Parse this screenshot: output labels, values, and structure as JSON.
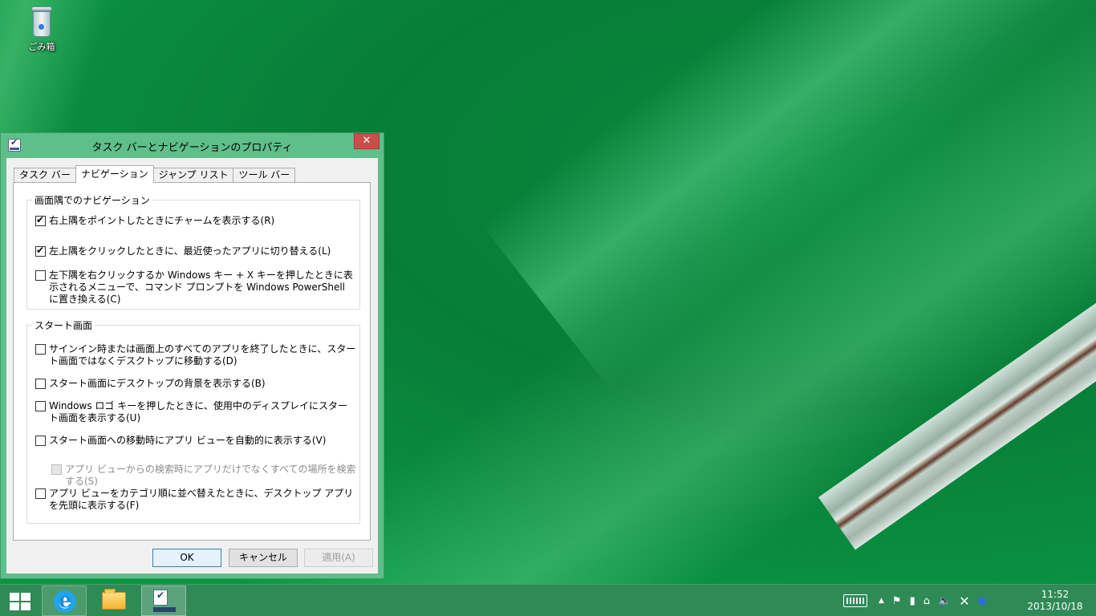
{
  "desktop": {
    "recycle_bin_label": "ごみ箱"
  },
  "window": {
    "title": "タスク バーとナビゲーションのプロパティ",
    "close_glyph": "✕",
    "tabs": [
      {
        "label": "タスク バー",
        "active": false
      },
      {
        "label": "ナビゲーション",
        "active": true
      },
      {
        "label": "ジャンプ リスト",
        "active": false
      },
      {
        "label": "ツール バー",
        "active": false
      }
    ],
    "corner_group": {
      "title": "画面隅でのナビゲーション",
      "options": [
        {
          "label": "右上隅をポイントしたときにチャームを表示する(R)",
          "checked": true
        },
        {
          "label": "左上隅をクリックしたときに、最近使ったアプリに切り替える(L)",
          "checked": true
        },
        {
          "label": "左下隅を右クリックするか Windows キー + X キーを押したときに表示されるメニューで、コマンド プロンプトを Windows PowerShell に置き換える(C)",
          "checked": false
        }
      ]
    },
    "start_group": {
      "title": "スタート画面",
      "options": [
        {
          "label": "サインイン時または画面上のすべてのアプリを終了したときに、スタート画面ではなくデスクトップに移動する(D)",
          "checked": false
        },
        {
          "label": "スタート画面にデスクトップの背景を表示する(B)",
          "checked": false
        },
        {
          "label": "Windows ロゴ キーを押したときに、使用中のディスプレイにスタート画面を表示する(U)",
          "checked": false
        },
        {
          "label": "スタート画面への移動時にアプリ ビューを自動的に表示する(V)",
          "checked": false
        },
        {
          "label": "アプリ ビューからの検索時にアプリだけでなくすべての場所を検索する(S)",
          "checked": false,
          "disabled": true
        },
        {
          "label": "アプリ ビューをカテゴリ順に並べ替えたときに、デスクトップ アプリを先頭に表示する(F)",
          "checked": false
        }
      ]
    },
    "buttons": {
      "ok": "OK",
      "cancel": "キャンセル",
      "apply": "適用(A)"
    }
  },
  "taskbar": {
    "pinned": [
      "start-icon",
      "internet-explorer-icon",
      "file-explorer-icon",
      "taskbar-properties-icon"
    ],
    "tray": {
      "icons": [
        "keyboard-icon",
        "show-hidden-icons",
        "flag-icon",
        "battery-icon",
        "network-icon",
        "volume-icon",
        "close-x-icon",
        "ime-icon"
      ],
      "show_hidden_glyph": "▲",
      "flag_glyph": "⚑",
      "battery_glyph": "▮",
      "network_glyph": "⌂",
      "volume_glyph": "🔈",
      "x_glyph": "✕",
      "ime_glyph": "●"
    },
    "clock": {
      "time": "11:52",
      "date": "2013/10/18"
    }
  },
  "colors": {
    "accent": "#5fbf8b",
    "taskbar": "#2f8a56",
    "close_button": "#c7504f",
    "wallpaper": "#0a8a3e"
  }
}
